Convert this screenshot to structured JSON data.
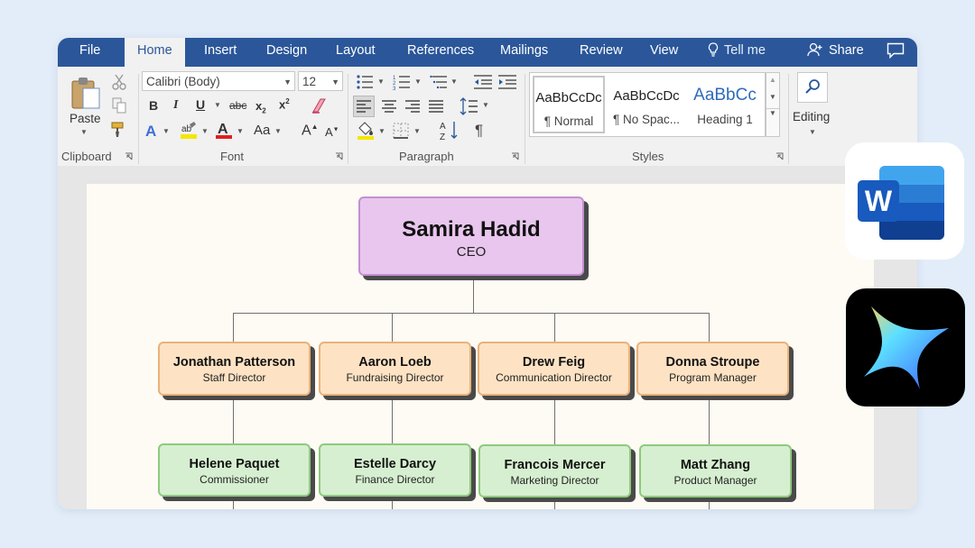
{
  "tabs": [
    {
      "label": "File",
      "active": false
    },
    {
      "label": "Home",
      "active": true
    },
    {
      "label": "Insert",
      "active": false
    },
    {
      "label": "Design",
      "active": false
    },
    {
      "label": "Layout",
      "active": false
    },
    {
      "label": "References",
      "active": false
    },
    {
      "label": "Mailings",
      "active": false
    },
    {
      "label": "Review",
      "active": false
    },
    {
      "label": "View",
      "active": false
    }
  ],
  "tell_me": "Tell me",
  "share": "Share",
  "clipboard": {
    "paste": "Paste",
    "label": "Clipboard"
  },
  "font": {
    "name": "Calibri (Body)",
    "size": "12",
    "label": "Font",
    "change_case": "Aa"
  },
  "paragraph": {
    "label": "Paragraph"
  },
  "styles": {
    "label": "Styles",
    "items": [
      {
        "sample": "AaBbCcDc",
        "name": "¶ Normal"
      },
      {
        "sample": "AaBbCcDc",
        "name": "¶ No Spac..."
      },
      {
        "sample": "AaBbCc",
        "name": "Heading 1"
      }
    ]
  },
  "editing": {
    "label": "Editing"
  },
  "org_chart": {
    "ceo": {
      "name": "Samira Hadid",
      "role": "CEO"
    },
    "directors": [
      {
        "name": "Jonathan Patterson",
        "role": "Staff Director"
      },
      {
        "name": "Aaron Loeb",
        "role": "Fundraising Director"
      },
      {
        "name": "Drew Feig",
        "role": "Communication Director"
      },
      {
        "name": "Donna Stroupe",
        "role": "Program Manager"
      }
    ],
    "reports": [
      {
        "name": "Helene Paquet",
        "role": "Commissioner"
      },
      {
        "name": "Estelle Darcy",
        "role": "Finance Director"
      },
      {
        "name": "Francois Mercer",
        "role": "Marketing Director"
      },
      {
        "name": "Matt Zhang",
        "role": "Product Manager"
      }
    ]
  },
  "colors": {
    "word_blue": "#2b579a",
    "ceo_fill": "#e8c6ed",
    "director_fill": "#fde2c4",
    "report_fill": "#d6efd0"
  },
  "apps": [
    {
      "icon": "word-icon",
      "letter": "W"
    },
    {
      "icon": "ai-star-icon"
    }
  ]
}
